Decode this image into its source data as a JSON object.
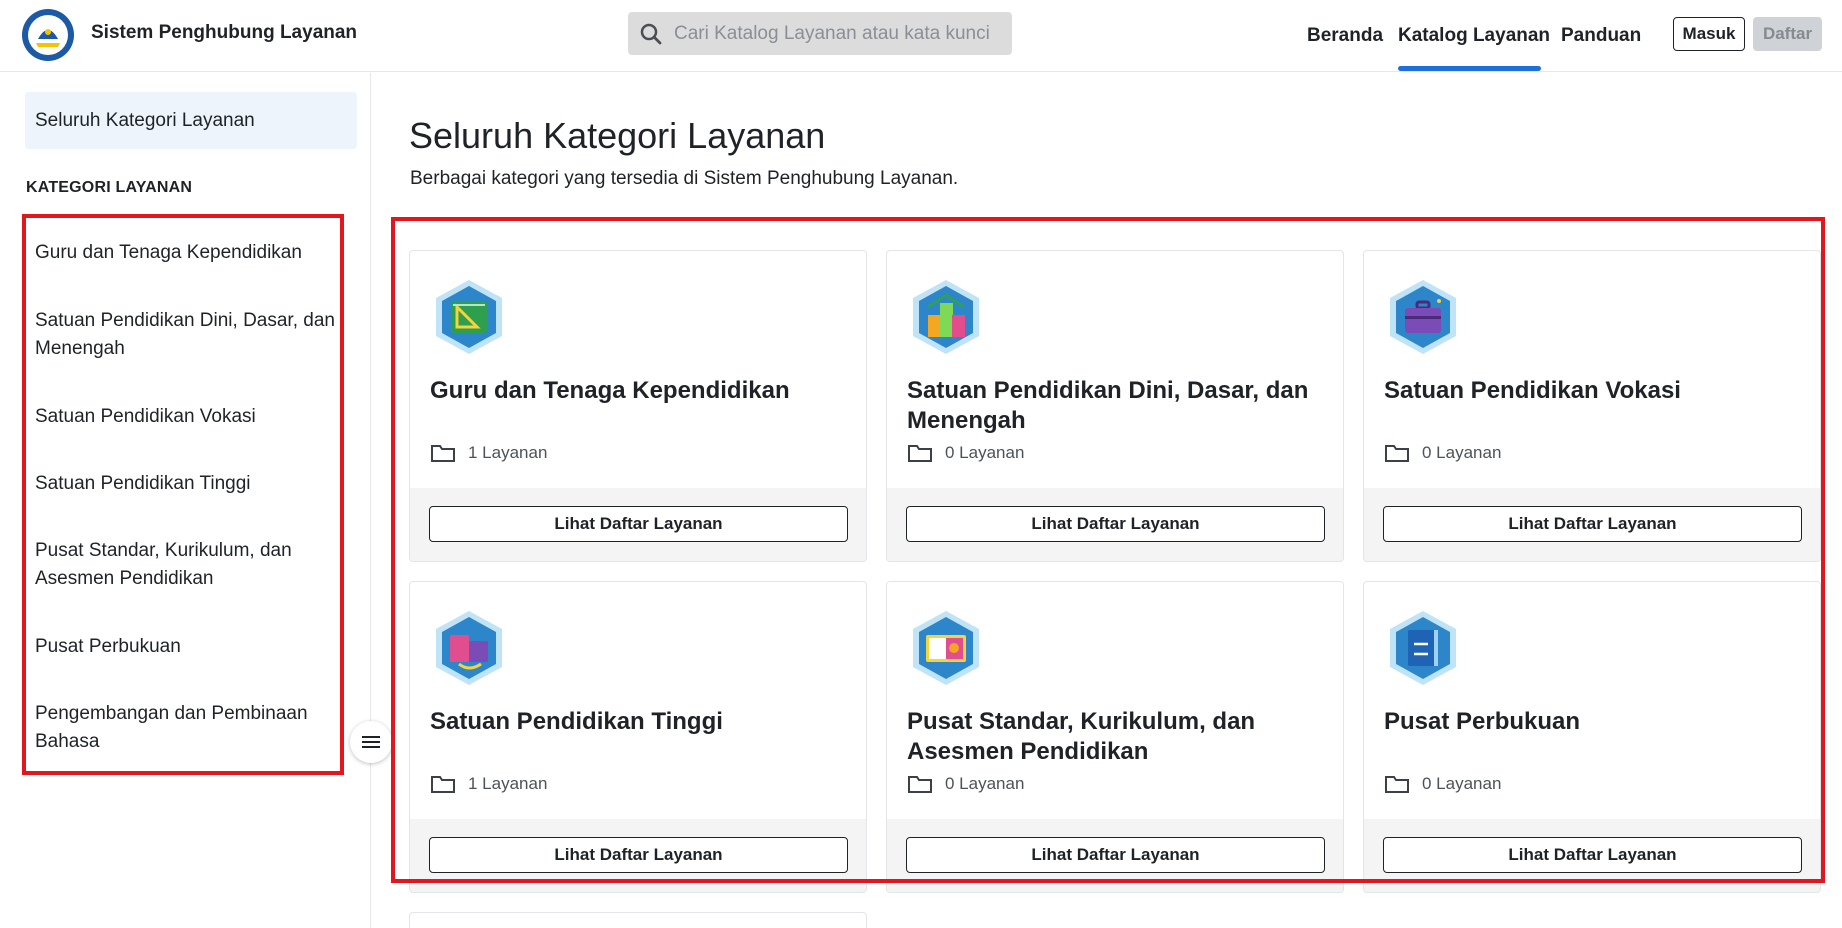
{
  "header": {
    "app_title": "Sistem Penghubung Layanan",
    "search_placeholder": "Cari Katalog Layanan atau kata kunci",
    "search_icon": "search-icon",
    "nav": [
      {
        "label": "Beranda",
        "active": false
      },
      {
        "label": "Katalog Layanan",
        "active": true
      },
      {
        "label": "Panduan",
        "active": false
      }
    ],
    "login_label": "Masuk",
    "register_label": "Daftar",
    "accent_color": "#1e6fd9"
  },
  "sidebar": {
    "all_label": "Seluruh Kategori Layanan",
    "heading": "KATEGORI LAYANAN",
    "items": [
      {
        "label": "Guru dan Tenaga Kependidikan"
      },
      {
        "label": "Satuan Pendidikan Dini, Dasar, dan Menengah"
      },
      {
        "label": "Satuan Pendidikan Vokasi"
      },
      {
        "label": "Satuan Pendidikan Tinggi"
      },
      {
        "label": "Pusat Standar, Kurikulum, dan Asesmen Pendidikan"
      },
      {
        "label": "Pusat Perbukuan"
      },
      {
        "label": "Pengembangan dan Pembinaan Bahasa"
      }
    ],
    "collapse_icon": "hamburger-icon"
  },
  "main": {
    "title": "Seluruh Kategori Layanan",
    "subtitle": "Berbagai kategori yang tersedia di Sistem Penghubung Layanan.",
    "cards": [
      {
        "title": "Guru dan Tenaga Kependidikan",
        "count": "1 Layanan",
        "button": "Lihat Daftar Layanan",
        "icon": "ruler-board-icon"
      },
      {
        "title": "Satuan Pendidikan Dini, Dasar, dan Menengah",
        "count": "0 Layanan",
        "button": "Lihat Daftar Layanan",
        "icon": "number-blocks-icon"
      },
      {
        "title": "Satuan Pendidikan Vokasi",
        "count": "0 Layanan",
        "button": "Lihat Daftar Layanan",
        "icon": "briefcase-icon"
      },
      {
        "title": "Satuan Pendidikan Tinggi",
        "count": "1 Layanan",
        "button": "Lihat Daftar Layanan",
        "icon": "book-briefcase-icon"
      },
      {
        "title": "Pusat Standar, Kurikulum, dan Asesmen Pendidikan",
        "count": "0 Layanan",
        "button": "Lihat Daftar Layanan",
        "icon": "assessment-board-icon"
      },
      {
        "title": "Pusat Perbukuan",
        "count": "0 Layanan",
        "button": "Lihat Daftar Layanan",
        "icon": "dictionary-book-icon"
      }
    ]
  },
  "colors": {
    "highlight": "#e3161f",
    "sidebar_active_bg": "#eef4fc",
    "card_footer_bg": "#f4f4f4"
  }
}
